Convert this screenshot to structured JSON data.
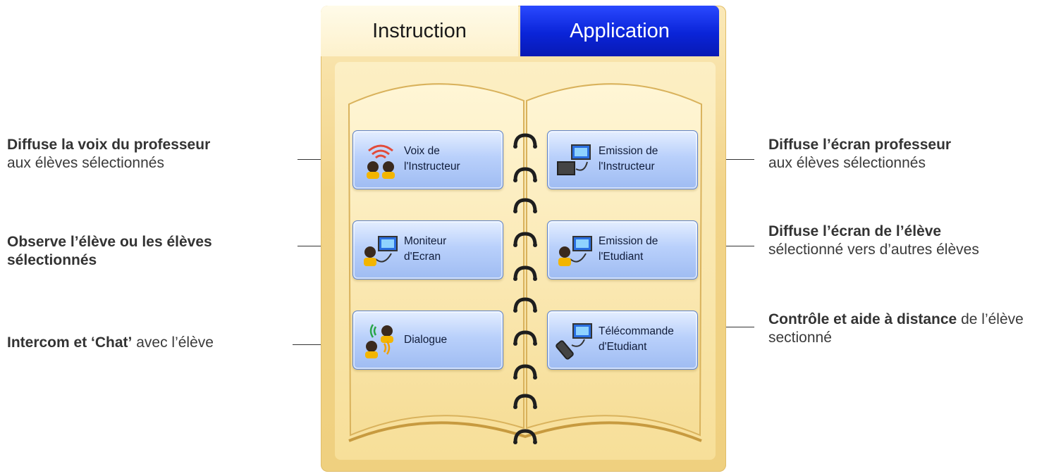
{
  "tabs": {
    "instruction": "Instruction",
    "application": "Application"
  },
  "buttons": {
    "voix_instructeur": "Voix de\nl'Instructeur",
    "emission_instructeur": "Emission de\nl'Instructeur",
    "moniteur_ecran": "Moniteur\nd'Ecran",
    "emission_etudiant": "Emission de\nl'Etudiant",
    "dialogue": "Dialogue",
    "telecommande_etudiant": "Télécommande\nd'Etudiant"
  },
  "annotations": {
    "left1_bold": "Diffuse la voix du professeur",
    "left1_rest": "aux élèves sélectionnés",
    "left2_bold": "Observe l’élève ou les élèves sélectionnés",
    "left3_bold": "Intercom et ‘Chat’",
    "left3_rest": " avec l’élève",
    "right1_bold": "Diffuse l’écran professeur",
    "right1_rest": "aux élèves sélectionnés",
    "right2_bold": "Diffuse l’écran de l’élève",
    "right2_rest": "sélectionné vers d’autres élèves",
    "right3_bold": "Contrôle et aide à distance",
    "right3_rest": " de l’élève sectionné"
  },
  "colors": {
    "panel": "#f2d489",
    "tab_active": "#fdf1cc",
    "tab_inactive": "#0a24d8",
    "button": "#b9d0fb"
  }
}
